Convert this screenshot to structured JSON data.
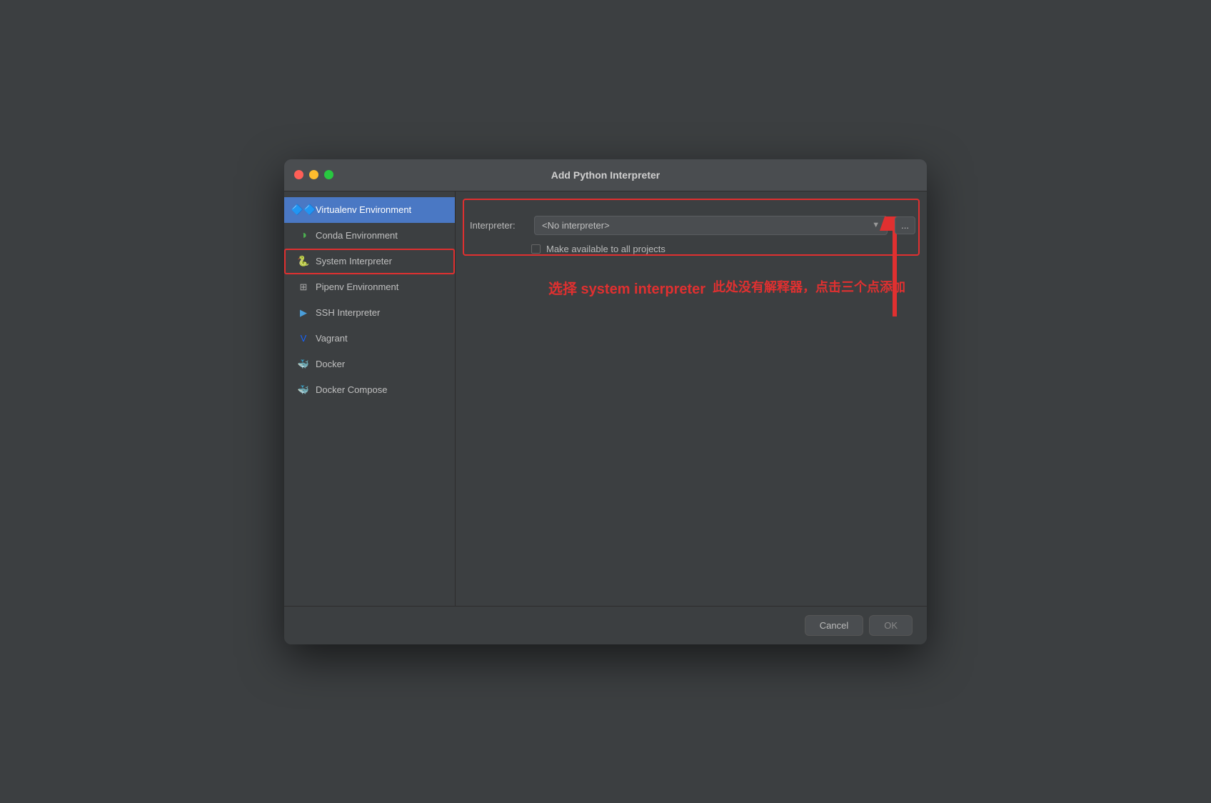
{
  "dialog": {
    "title": "Add Python Interpreter"
  },
  "sidebar": {
    "items": [
      {
        "id": "virtualenv",
        "label": "Virtualenv Environment",
        "icon": "virtualenv",
        "active": true
      },
      {
        "id": "conda",
        "label": "Conda Environment",
        "icon": "conda",
        "active": false
      },
      {
        "id": "system",
        "label": "System Interpreter",
        "icon": "system",
        "active": false,
        "highlighted": true
      },
      {
        "id": "pipenv",
        "label": "Pipenv Environment",
        "icon": "pipenv",
        "active": false
      },
      {
        "id": "ssh",
        "label": "SSH Interpreter",
        "icon": "ssh",
        "active": false
      },
      {
        "id": "vagrant",
        "label": "Vagrant",
        "icon": "vagrant",
        "active": false
      },
      {
        "id": "docker",
        "label": "Docker",
        "icon": "docker",
        "active": false
      },
      {
        "id": "docker-compose",
        "label": "Docker Compose",
        "icon": "docker-compose",
        "active": false
      }
    ]
  },
  "main": {
    "interpreter_label": "Interpreter:",
    "interpreter_value": "<No interpreter>",
    "checkbox_label": "Make available to all projects",
    "three_dots": "..."
  },
  "annotations": {
    "text1": "选择 system interpreter",
    "text2": "此处没有解释器，点击三个点添加"
  },
  "footer": {
    "cancel": "Cancel",
    "ok": "OK"
  }
}
